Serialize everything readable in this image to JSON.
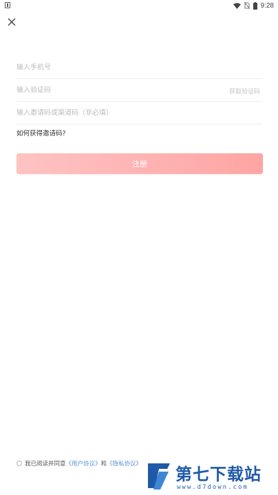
{
  "status_bar": {
    "time": "9:28",
    "icons": [
      "app-notification-icon",
      "wifi-icon",
      "no-sim-icon",
      "battery-icon"
    ]
  },
  "form": {
    "phone_placeholder": "输入手机号",
    "code_placeholder": "输入验证码",
    "get_code_label": "获取验证码",
    "invite_placeholder": "输入邀请码或渠道码（非必填）",
    "invite_help": "如何获得邀请码?",
    "register_label": "注册"
  },
  "agreement": {
    "prefix": "我已阅读并同意",
    "user_agreement": "《用户协议》",
    "and": "和",
    "privacy_policy": "《隐私协议》"
  },
  "watermark": {
    "title": "第七下载站",
    "url": "www.d7down.com"
  },
  "colors": {
    "button_start": "#ffc3c3",
    "button_end": "#fea5a3",
    "link": "#5b92d8",
    "logo_blue": "#1f5aa8"
  }
}
